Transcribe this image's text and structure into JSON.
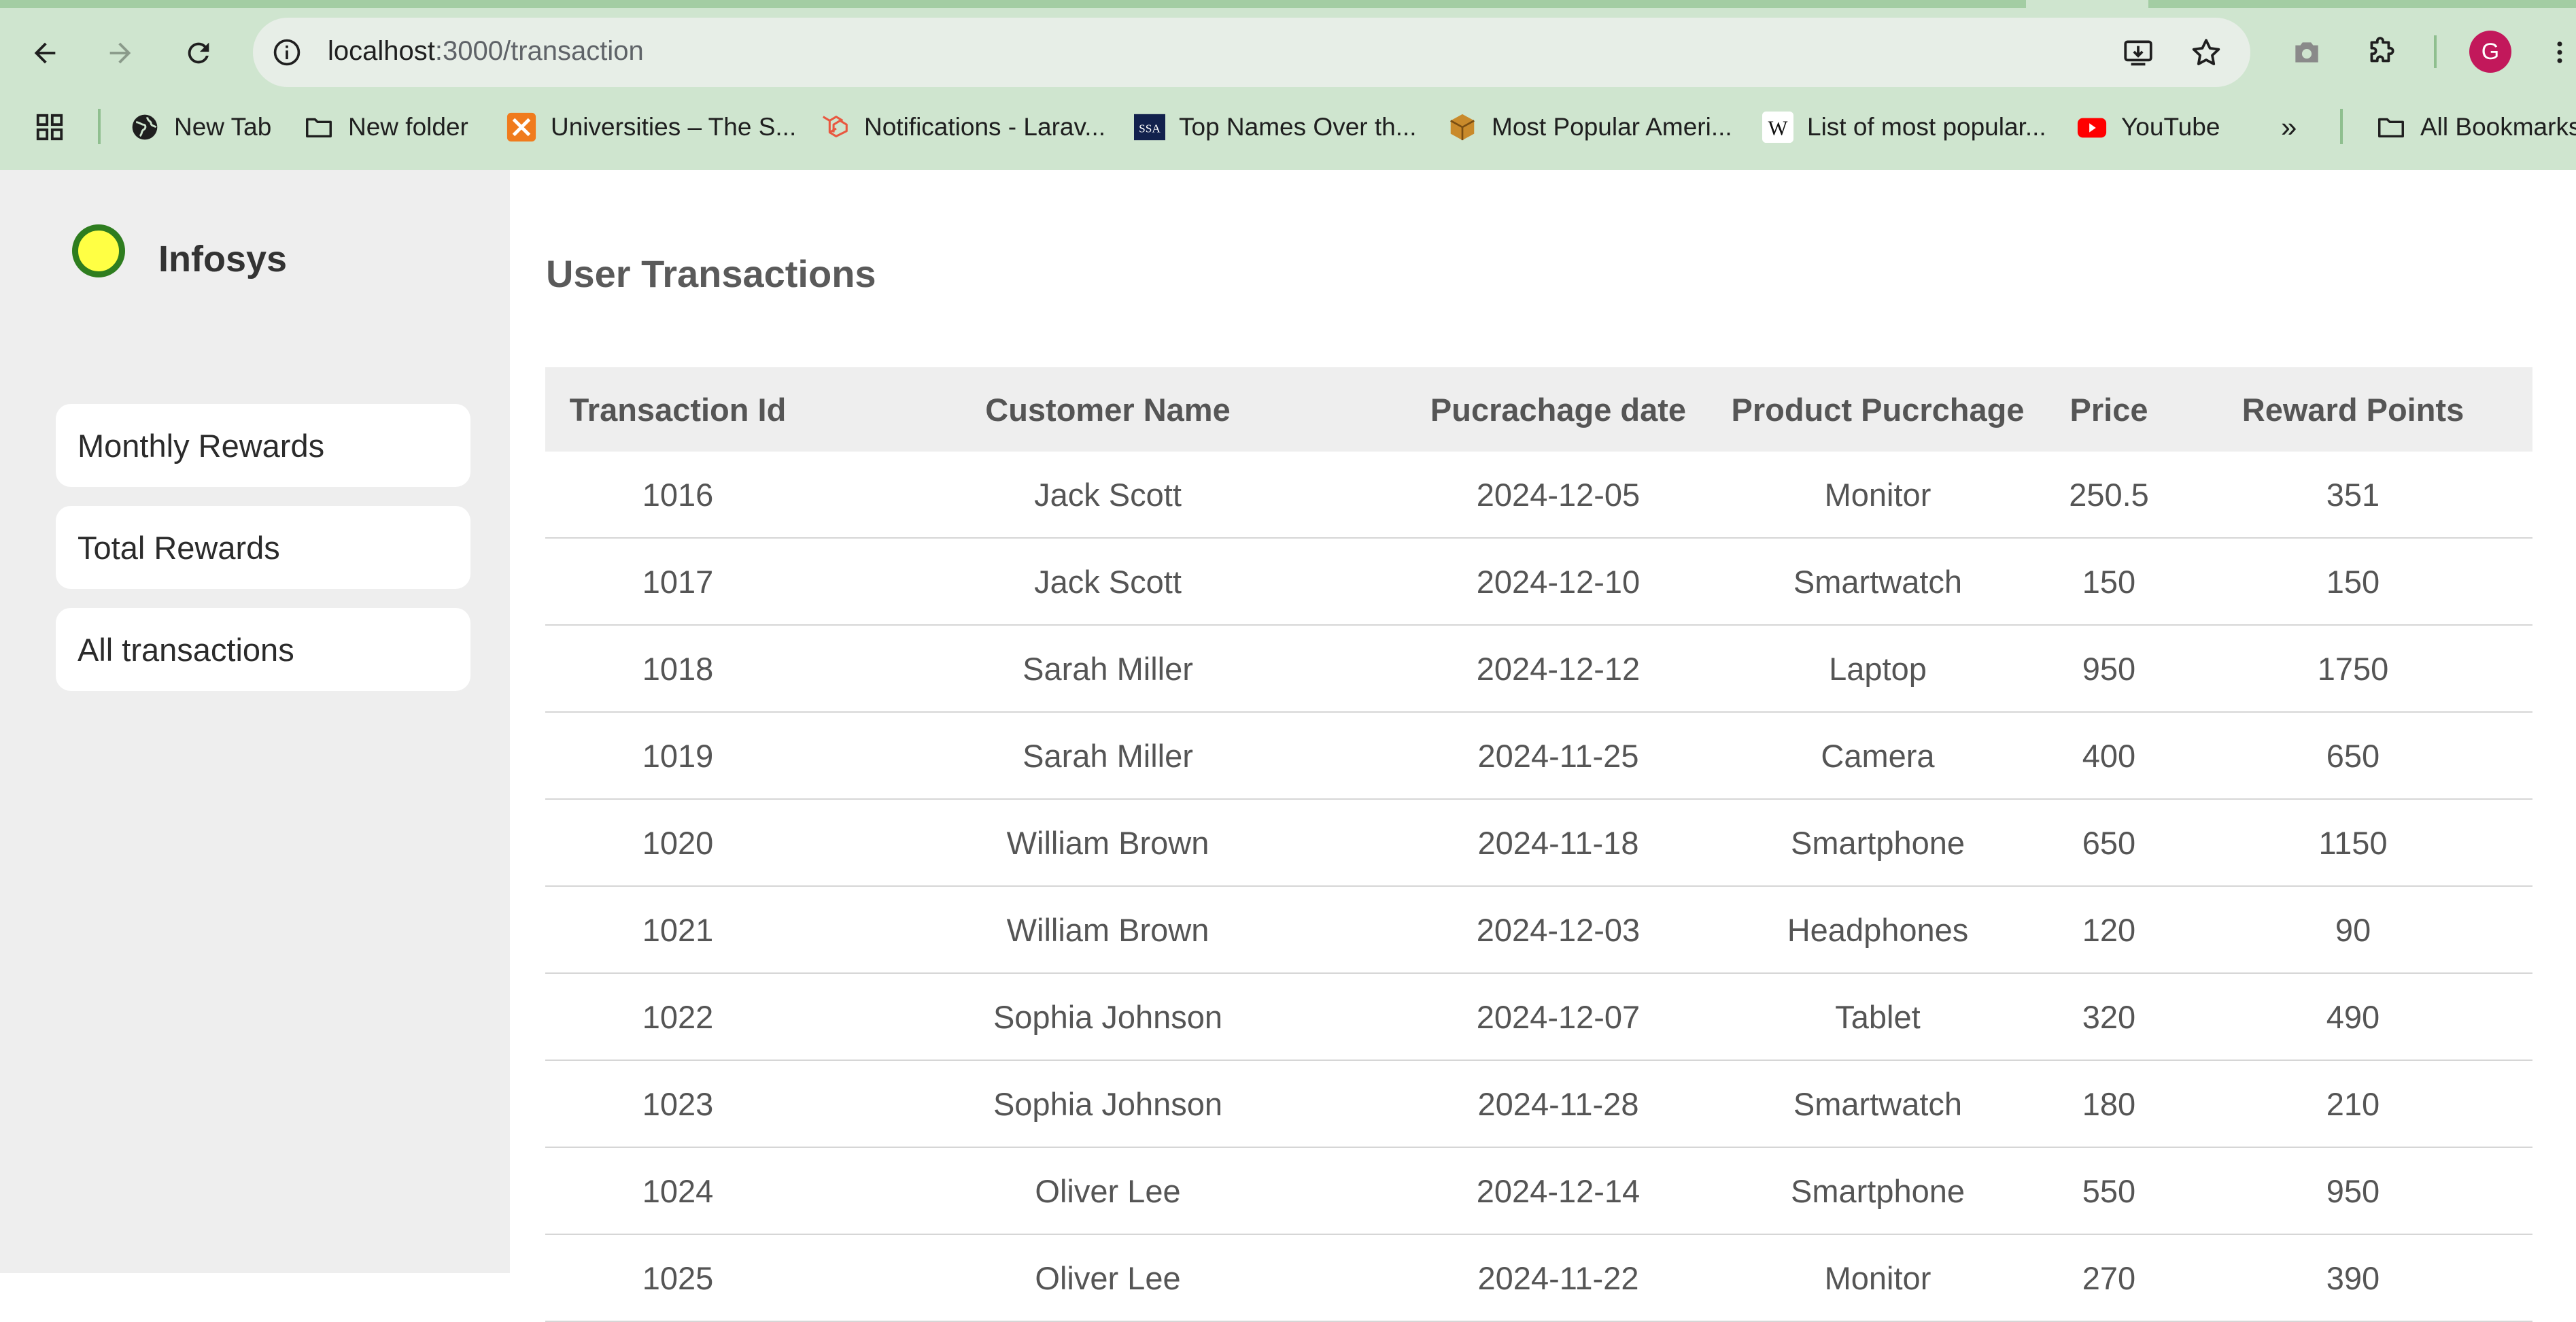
{
  "browser": {
    "url_host": "localhost",
    "url_path": ":3000/transaction",
    "avatar_letter": "G",
    "bookmarks": [
      {
        "label": "New Tab",
        "icon": "globe-icon"
      },
      {
        "label": "New folder",
        "icon": "folder-icon"
      },
      {
        "label": "Universities – The S...",
        "icon": "xampp-icon"
      },
      {
        "label": "Notifications - Larav...",
        "icon": "laravel-icon"
      },
      {
        "label": "Top Names Over th...",
        "icon": "ssa-icon"
      },
      {
        "label": "Most Popular Ameri...",
        "icon": "box-icon"
      },
      {
        "label": "List of most popular...",
        "icon": "wikipedia-icon"
      },
      {
        "label": "YouTube",
        "icon": "youtube-icon"
      }
    ],
    "overflow_label": "»",
    "all_bookmarks_label": "All Bookmarks"
  },
  "sidebar": {
    "brand": "Infosys",
    "items": [
      {
        "label": "Monthly Rewards"
      },
      {
        "label": "Total Rewards"
      },
      {
        "label": "All transactions"
      }
    ]
  },
  "main": {
    "title": "User Transactions",
    "columns": [
      "Transaction Id",
      "Customer Name",
      "Pucrachage date",
      "Product Pucrchage",
      "Price",
      "Reward Points"
    ],
    "rows": [
      [
        "1016",
        "Jack Scott",
        "2024-12-05",
        "Monitor",
        "250.5",
        "351"
      ],
      [
        "1017",
        "Jack Scott",
        "2024-12-10",
        "Smartwatch",
        "150",
        "150"
      ],
      [
        "1018",
        "Sarah Miller",
        "2024-12-12",
        "Laptop",
        "950",
        "1750"
      ],
      [
        "1019",
        "Sarah Miller",
        "2024-11-25",
        "Camera",
        "400",
        "650"
      ],
      [
        "1020",
        "William Brown",
        "2024-11-18",
        "Smartphone",
        "650",
        "1150"
      ],
      [
        "1021",
        "William Brown",
        "2024-12-03",
        "Headphones",
        "120",
        "90"
      ],
      [
        "1022",
        "Sophia Johnson",
        "2024-12-07",
        "Tablet",
        "320",
        "490"
      ],
      [
        "1023",
        "Sophia Johnson",
        "2024-11-28",
        "Smartwatch",
        "180",
        "210"
      ],
      [
        "1024",
        "Oliver Lee",
        "2024-12-14",
        "Smartphone",
        "550",
        "950"
      ],
      [
        "1025",
        "Oliver Lee",
        "2024-11-22",
        "Monitor",
        "270",
        "390"
      ]
    ]
  },
  "colors": {
    "chrome_bg": "#cfe5cf",
    "sidebar_bg": "#eeeeee",
    "logo_fill": "#ffff44",
    "logo_ring": "#2e7d1f"
  }
}
